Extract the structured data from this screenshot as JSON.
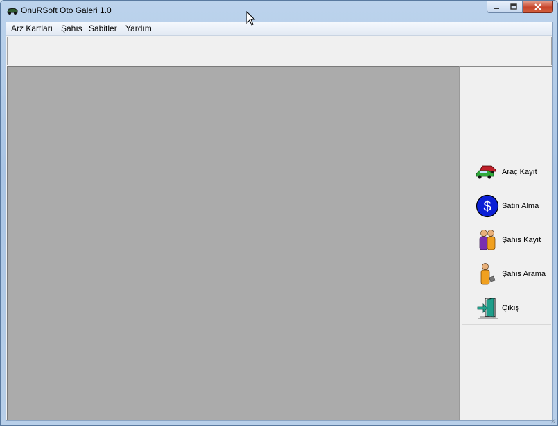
{
  "window": {
    "title": "OnuRSoft Oto Galeri 1.0"
  },
  "menu": [
    {
      "label": "Arz Kartları"
    },
    {
      "label": "Şahıs"
    },
    {
      "label": "Sabitler"
    },
    {
      "label": "Yardım"
    }
  ],
  "side_buttons": [
    {
      "label": "Araç Kayıt",
      "icon": "cars-icon"
    },
    {
      "label": "Satın Alma",
      "icon": "dollar-icon"
    },
    {
      "label": "Şahıs Kayıt",
      "icon": "people-icon"
    },
    {
      "label": "Şahıs Arama",
      "icon": "person-search-icon"
    },
    {
      "label": "Çıkış",
      "icon": "exit-door-icon"
    }
  ],
  "colors": {
    "mdi_background": "#ababab",
    "panel": "#f0f0f0",
    "close_button": "#c7452b"
  }
}
